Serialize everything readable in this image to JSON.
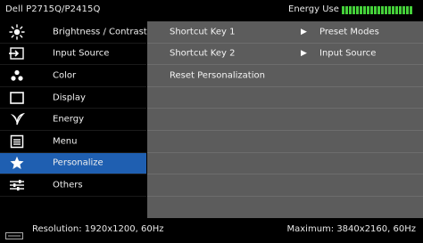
{
  "header": {
    "model": "Dell P2715Q/P2415Q",
    "energy_label": "Energy Use",
    "energy_level": 1.0
  },
  "menu": {
    "items": [
      {
        "label": "Brightness / Contrast",
        "icon": "brightness-icon"
      },
      {
        "label": "Input Source",
        "icon": "input-source-icon"
      },
      {
        "label": "Color",
        "icon": "color-icon"
      },
      {
        "label": "Display",
        "icon": "display-icon"
      },
      {
        "label": "Energy",
        "icon": "energy-icon"
      },
      {
        "label": "Menu",
        "icon": "menu-icon"
      },
      {
        "label": "Personalize",
        "icon": "star-icon",
        "active": true
      },
      {
        "label": "Others",
        "icon": "sliders-icon"
      }
    ]
  },
  "panel": {
    "rows": [
      {
        "key": "Shortcut Key 1",
        "value": "Preset Modes"
      },
      {
        "key": "Shortcut Key 2",
        "value": "Input Source"
      },
      {
        "key": "Reset Personalization",
        "value": ""
      }
    ],
    "arrow": "▶"
  },
  "footer": {
    "resolution": "Resolution: 1920x1200, 60Hz",
    "maximum": "Maximum: 3840x2160, 60Hz"
  },
  "colors": {
    "active_blue": "#1f5fb1",
    "panel_gray": "#5c5c5c",
    "energy_green": "#45d13a"
  }
}
